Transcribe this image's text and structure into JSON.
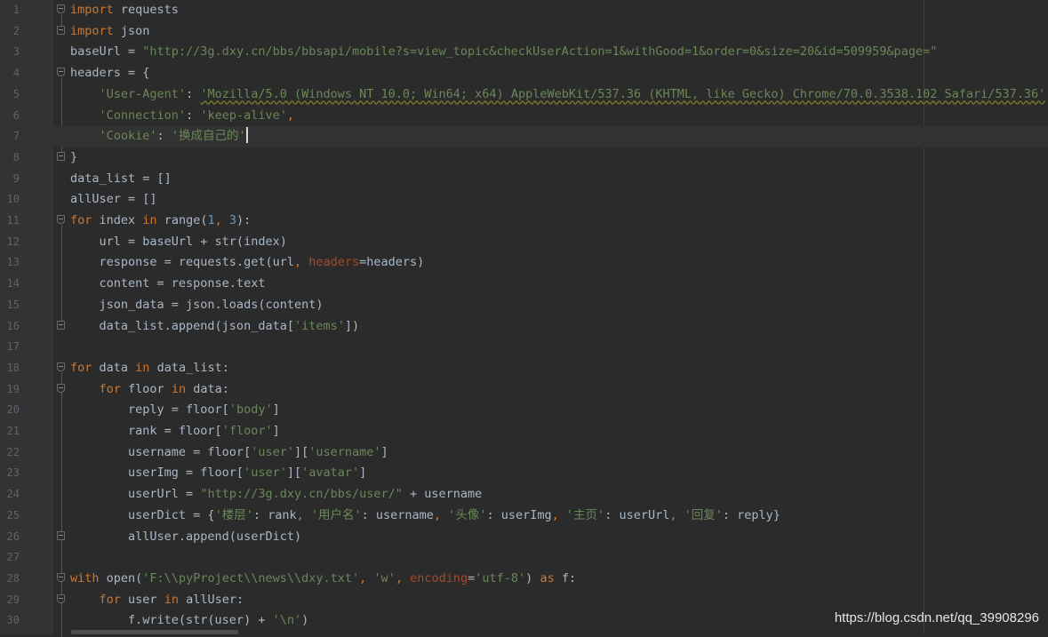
{
  "watermark": "https://blog.csdn.net/qq_39908296",
  "code_lines": [
    {
      "n": "1",
      "fold": "open",
      "tokens": [
        {
          "t": "kw",
          "v": "import"
        },
        {
          "t": "",
          "v": " requests"
        }
      ]
    },
    {
      "n": "2",
      "fold": "close",
      "tokens": [
        {
          "t": "kw",
          "v": "import"
        },
        {
          "t": "",
          "v": " json"
        }
      ]
    },
    {
      "n": "3",
      "tokens": [
        {
          "t": "",
          "v": "baseUrl = "
        },
        {
          "t": "str",
          "v": "\"http://3g.dxy.cn/bbs/bbsapi/mobile?s=view_topic&checkUserAction=1&withGood=1&order=0&size=20&id=509959&page=\""
        }
      ]
    },
    {
      "n": "4",
      "fold": "open",
      "tokens": [
        {
          "t": "",
          "v": "headers = {"
        }
      ]
    },
    {
      "n": "5",
      "tokens": [
        {
          "t": "",
          "v": "    "
        },
        {
          "t": "str",
          "v": "'User-Agent'"
        },
        {
          "t": "",
          "v": ": "
        },
        {
          "t": "strwarn",
          "v": "'Mozilla/5.0 (Windows NT 10.0; Win64; x64) AppleWebKit/537.36 (KHTML, like Gecko) Chrome/70.0.3538.102 Safari/537.36'"
        },
        {
          "t": "kw",
          "v": ","
        }
      ]
    },
    {
      "n": "6",
      "tokens": [
        {
          "t": "",
          "v": "    "
        },
        {
          "t": "str",
          "v": "'Connection'"
        },
        {
          "t": "",
          "v": ": "
        },
        {
          "t": "str",
          "v": "'keep-alive'"
        },
        {
          "t": "kw",
          "v": ","
        }
      ]
    },
    {
      "n": "7",
      "current": true,
      "tokens": [
        {
          "t": "",
          "v": "    "
        },
        {
          "t": "str",
          "v": "'Cookie'"
        },
        {
          "t": "",
          "v": ": "
        },
        {
          "t": "str",
          "v": "'换成自己的'"
        },
        {
          "t": "caret",
          "v": ""
        }
      ]
    },
    {
      "n": "8",
      "fold": "close",
      "tokens": [
        {
          "t": "",
          "v": "}"
        }
      ]
    },
    {
      "n": "9",
      "tokens": [
        {
          "t": "",
          "v": "data_list = []"
        }
      ]
    },
    {
      "n": "10",
      "tokens": [
        {
          "t": "",
          "v": "allUser = []"
        }
      ]
    },
    {
      "n": "11",
      "fold": "open",
      "tokens": [
        {
          "t": "kw",
          "v": "for"
        },
        {
          "t": "",
          "v": " index "
        },
        {
          "t": "kw",
          "v": "in"
        },
        {
          "t": "",
          "v": " range("
        },
        {
          "t": "num",
          "v": "1"
        },
        {
          "t": "kw",
          "v": ","
        },
        {
          "t": "",
          "v": " "
        },
        {
          "t": "num",
          "v": "3"
        },
        {
          "t": "",
          "v": "):"
        }
      ]
    },
    {
      "n": "12",
      "tokens": [
        {
          "t": "",
          "v": "    url = baseUrl + str(index)"
        }
      ]
    },
    {
      "n": "13",
      "tokens": [
        {
          "t": "",
          "v": "    response = requests.get(url"
        },
        {
          "t": "kw",
          "v": ","
        },
        {
          "t": "",
          "v": " "
        },
        {
          "t": "param",
          "v": "headers"
        },
        {
          "t": "",
          "v": "=headers)"
        }
      ]
    },
    {
      "n": "14",
      "tokens": [
        {
          "t": "",
          "v": "    content = response.text"
        }
      ]
    },
    {
      "n": "15",
      "tokens": [
        {
          "t": "",
          "v": "    json_data = json.loads(content)"
        }
      ]
    },
    {
      "n": "16",
      "fold": "close",
      "tokens": [
        {
          "t": "",
          "v": "    data_list.append(json_data["
        },
        {
          "t": "str",
          "v": "'items'"
        },
        {
          "t": "",
          "v": "])"
        }
      ]
    },
    {
      "n": "17",
      "tokens": []
    },
    {
      "n": "18",
      "fold": "open",
      "tokens": [
        {
          "t": "kw",
          "v": "for"
        },
        {
          "t": "",
          "v": " data "
        },
        {
          "t": "kw",
          "v": "in"
        },
        {
          "t": "",
          "v": " data_list:"
        }
      ]
    },
    {
      "n": "19",
      "fold": "open",
      "tokens": [
        {
          "t": "",
          "v": "    "
        },
        {
          "t": "kw",
          "v": "for"
        },
        {
          "t": "",
          "v": " floor "
        },
        {
          "t": "kw",
          "v": "in"
        },
        {
          "t": "",
          "v": " data:"
        }
      ]
    },
    {
      "n": "20",
      "tokens": [
        {
          "t": "",
          "v": "        reply = floor["
        },
        {
          "t": "str",
          "v": "'body'"
        },
        {
          "t": "",
          "v": "]"
        }
      ]
    },
    {
      "n": "21",
      "tokens": [
        {
          "t": "",
          "v": "        rank = floor["
        },
        {
          "t": "str",
          "v": "'floor'"
        },
        {
          "t": "",
          "v": "]"
        }
      ]
    },
    {
      "n": "22",
      "tokens": [
        {
          "t": "",
          "v": "        username = floor["
        },
        {
          "t": "str",
          "v": "'user'"
        },
        {
          "t": "",
          "v": "]["
        },
        {
          "t": "str",
          "v": "'username'"
        },
        {
          "t": "",
          "v": "]"
        }
      ]
    },
    {
      "n": "23",
      "tokens": [
        {
          "t": "",
          "v": "        userImg = floor["
        },
        {
          "t": "str",
          "v": "'user'"
        },
        {
          "t": "",
          "v": "]["
        },
        {
          "t": "str",
          "v": "'avatar'"
        },
        {
          "t": "",
          "v": "]"
        }
      ]
    },
    {
      "n": "24",
      "tokens": [
        {
          "t": "",
          "v": "        userUrl = "
        },
        {
          "t": "str",
          "v": "\"http://3g.dxy.cn/bbs/user/\""
        },
        {
          "t": "",
          "v": " + username"
        }
      ]
    },
    {
      "n": "25",
      "tokens": [
        {
          "t": "",
          "v": "        userDict = {"
        },
        {
          "t": "str",
          "v": "'楼层'"
        },
        {
          "t": "",
          "v": ": rank"
        },
        {
          "t": "kw",
          "v": ","
        },
        {
          "t": "",
          "v": " "
        },
        {
          "t": "str",
          "v": "'用户名'"
        },
        {
          "t": "",
          "v": ": username"
        },
        {
          "t": "kw",
          "v": ","
        },
        {
          "t": "",
          "v": " "
        },
        {
          "t": "str",
          "v": "'头像'"
        },
        {
          "t": "",
          "v": ": userImg"
        },
        {
          "t": "kw",
          "v": ","
        },
        {
          "t": "",
          "v": " "
        },
        {
          "t": "str",
          "v": "'主页'"
        },
        {
          "t": "",
          "v": ": userUrl"
        },
        {
          "t": "kw",
          "v": ","
        },
        {
          "t": "",
          "v": " "
        },
        {
          "t": "str",
          "v": "'回复'"
        },
        {
          "t": "",
          "v": ": reply}"
        }
      ]
    },
    {
      "n": "26",
      "fold": "close",
      "tokens": [
        {
          "t": "",
          "v": "        allUser.append(userDict)"
        }
      ]
    },
    {
      "n": "27",
      "tokens": []
    },
    {
      "n": "28",
      "fold": "open",
      "tokens": [
        {
          "t": "kw",
          "v": "with"
        },
        {
          "t": "",
          "v": " open("
        },
        {
          "t": "str",
          "v": "'F:\\\\pyProject\\\\news\\\\dxy.txt'"
        },
        {
          "t": "kw",
          "v": ","
        },
        {
          "t": "",
          "v": " "
        },
        {
          "t": "str",
          "v": "'w'"
        },
        {
          "t": "kw",
          "v": ","
        },
        {
          "t": "",
          "v": " "
        },
        {
          "t": "param",
          "v": "encoding"
        },
        {
          "t": "",
          "v": "="
        },
        {
          "t": "str",
          "v": "'utf-8'"
        },
        {
          "t": "",
          "v": ") "
        },
        {
          "t": "kw",
          "v": "as"
        },
        {
          "t": "",
          "v": " f:"
        }
      ]
    },
    {
      "n": "29",
      "fold": "open",
      "tokens": [
        {
          "t": "",
          "v": "    "
        },
        {
          "t": "kw",
          "v": "for"
        },
        {
          "t": "",
          "v": " user "
        },
        {
          "t": "kw",
          "v": "in"
        },
        {
          "t": "",
          "v": " allUser:"
        }
      ]
    },
    {
      "n": "30",
      "tokens": [
        {
          "t": "",
          "v": "        f.write(str(user) + "
        },
        {
          "t": "str",
          "v": "'\\n'"
        },
        {
          "t": "",
          "v": ")"
        }
      ]
    }
  ]
}
